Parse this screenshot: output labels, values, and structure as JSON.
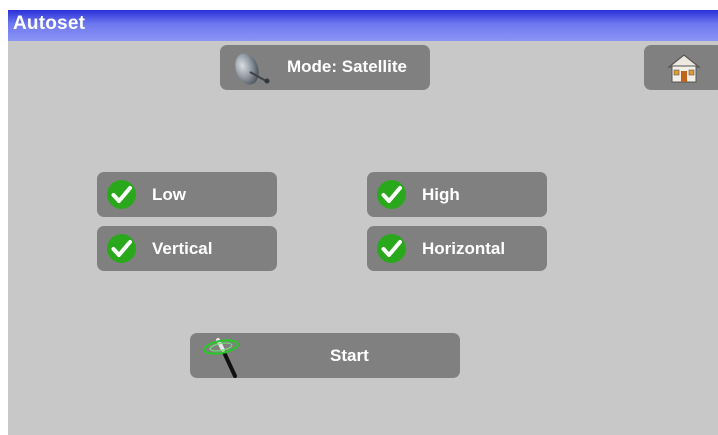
{
  "titlebar": {
    "title": "Autoset"
  },
  "mode": {
    "label": "Mode: Satellite",
    "icon": "satellite-dish-icon"
  },
  "home": {
    "icon": "home-icon"
  },
  "options": {
    "low": {
      "label": "Low",
      "checked": true
    },
    "high": {
      "label": "High",
      "checked": true
    },
    "vertical": {
      "label": "Vertical",
      "checked": true
    },
    "horizontal": {
      "label": "Horizontal",
      "checked": true
    }
  },
  "start": {
    "label": "Start",
    "icon": "wand-icon"
  },
  "colors": {
    "titlebar": "#2a2fd8",
    "button": "#808080",
    "background": "#c8c8c8",
    "check": "#2aa81c"
  }
}
